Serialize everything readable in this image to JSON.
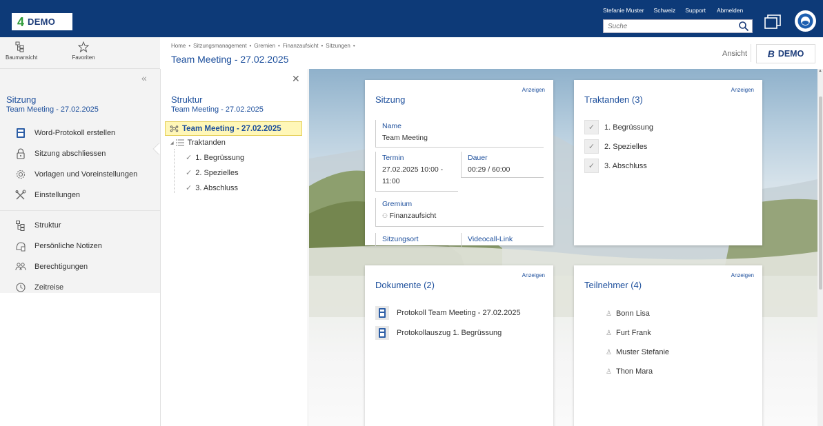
{
  "header": {
    "logo_mark": "4",
    "logo_text": "DEMO",
    "user": "Stefanie Muster",
    "country": "Schweiz",
    "support": "Support",
    "logout": "Abmelden",
    "search_placeholder": "Suche"
  },
  "toolbar": {
    "tree_view": "Baumansicht",
    "favorites": "Favoriten",
    "breadcrumb": [
      "Home",
      "Sitzungsmanagement",
      "Gremien",
      "Finanzaufsicht",
      "Sitzungen"
    ],
    "page_title": "Team Meeting - 27.02.2025",
    "view_label": "Ansicht",
    "brand_mark": "B",
    "brand_text": "DEMO"
  },
  "sidebar": {
    "heading": "Sitzung",
    "subheading": "Team Meeting - 27.02.2025",
    "items": [
      {
        "label": "Word-Protokoll erstellen",
        "icon": "word-file-icon"
      },
      {
        "label": "Sitzung abschliessen",
        "icon": "lock-icon"
      },
      {
        "label": "Vorlagen und Voreinstellungen",
        "icon": "gear-icon"
      },
      {
        "label": "Einstellungen",
        "icon": "tools-icon"
      }
    ],
    "items2": [
      {
        "label": "Struktur",
        "icon": "tree-icon"
      },
      {
        "label": "Persönliche Notizen",
        "icon": "notes-icon"
      },
      {
        "label": "Berechtigungen",
        "icon": "users-icon"
      },
      {
        "label": "Zeitreise",
        "icon": "clock-icon"
      }
    ]
  },
  "structure": {
    "heading": "Struktur",
    "subheading": "Team Meeting - 27.02.2025",
    "root": "Team Meeting - 27.02.2025",
    "group": "Traktanden",
    "items": [
      "1. Begrüssung",
      "2. Spezielles",
      "3. Abschluss"
    ]
  },
  "cards": {
    "show_label": "Anzeigen",
    "sitzung": {
      "title": "Sitzung",
      "name_label": "Name",
      "name_value": "Team Meeting",
      "termin_label": "Termin",
      "termin_value": "27.02.2025 10:00 - 11:00",
      "dauer_label": "Dauer",
      "dauer_value": "00:29 / 60:00",
      "gremium_label": "Gremium",
      "gremium_value": "Finanzaufsicht",
      "ort_label": "Sitzungsort",
      "video_label": "Videocall-Link"
    },
    "traktanden": {
      "title": "Traktanden (3)",
      "items": [
        "1. Begrüssung",
        "2. Spezielles",
        "3. Abschluss"
      ]
    },
    "dokumente": {
      "title": "Dokumente (2)",
      "items": [
        "Protokoll Team Meeting - 27.02.2025",
        "Protokollauszug 1. Begrüssung"
      ]
    },
    "teilnehmer": {
      "title": "Teilnehmer (4)",
      "items": [
        "Bonn Lisa",
        "Furt Frank",
        "Muster Stefanie",
        "Thon Mara"
      ]
    }
  }
}
